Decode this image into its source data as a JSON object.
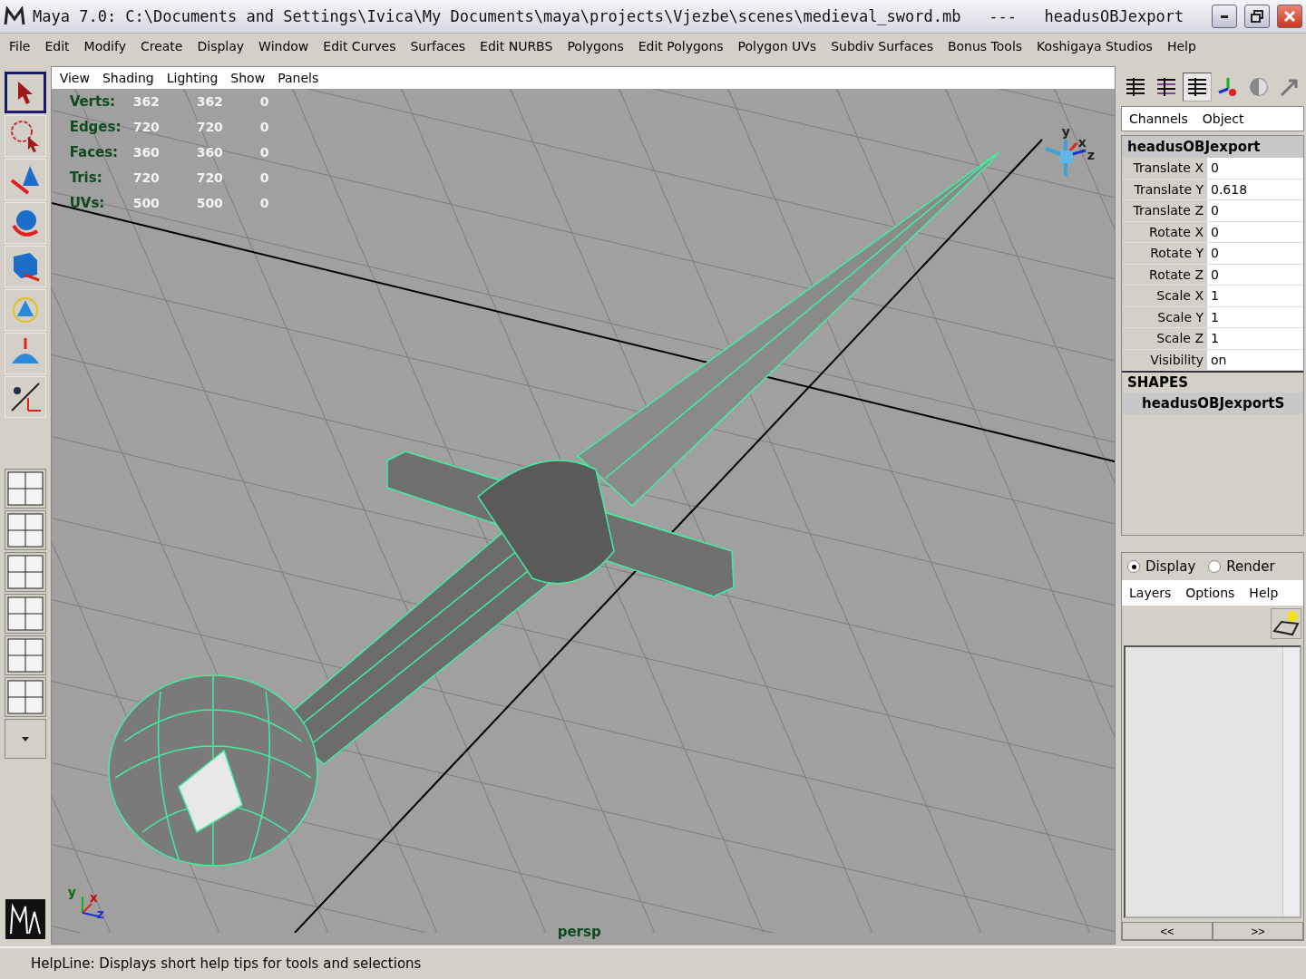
{
  "window": {
    "title": "Maya 7.0: C:\\Documents and Settings\\Ivica\\My Documents\\maya\\projects\\Vjezbe\\scenes\\medieval_sword.mb   ---   headusOBJexport"
  },
  "menu": [
    "File",
    "Edit",
    "Modify",
    "Create",
    "Display",
    "Window",
    "Edit Curves",
    "Surfaces",
    "Edit NURBS",
    "Polygons",
    "Edit Polygons",
    "Polygon UVs",
    "Subdiv Surfaces",
    "Bonus Tools",
    "Koshigaya Studios",
    "Help"
  ],
  "tools": [
    {
      "kind": "select",
      "selected": true
    },
    {
      "kind": "lasso",
      "selected": false
    },
    {
      "kind": "paint",
      "selected": false
    },
    {
      "kind": "rotate",
      "selected": false
    },
    {
      "kind": "scale",
      "selected": false
    },
    {
      "kind": "manip",
      "selected": false
    },
    {
      "kind": "soft",
      "selected": false
    },
    {
      "kind": "last",
      "selected": false
    }
  ],
  "viewport": {
    "menu": [
      "View",
      "Shading",
      "Lighting",
      "Show",
      "Panels"
    ],
    "hud": [
      {
        "label": "Verts:",
        "values": [
          "362",
          "362",
          "0"
        ]
      },
      {
        "label": "Edges:",
        "values": [
          "720",
          "720",
          "0"
        ]
      },
      {
        "label": "Faces:",
        "values": [
          "360",
          "360",
          "0"
        ]
      },
      {
        "label": "Tris:",
        "values": [
          "720",
          "720",
          "0"
        ]
      },
      {
        "label": "UVs:",
        "values": [
          "500",
          "500",
          "0"
        ]
      }
    ],
    "view_cube_axes": [
      "y",
      "x",
      "z"
    ],
    "origin_axes": [
      "y",
      "x",
      "z"
    ],
    "camera": "persp"
  },
  "channel_box": {
    "modes": [
      {
        "selected": false
      },
      {
        "selected": false
      },
      {
        "selected": true
      }
    ],
    "menu": [
      "Channels",
      "Object"
    ],
    "object": "headusOBJexport",
    "attributes": [
      {
        "name": "Translate X",
        "value": "0"
      },
      {
        "name": "Translate Y",
        "value": "0.618"
      },
      {
        "name": "Translate Z",
        "value": "0"
      },
      {
        "name": "Rotate X",
        "value": "0"
      },
      {
        "name": "Rotate Y",
        "value": "0"
      },
      {
        "name": "Rotate Z",
        "value": "0"
      },
      {
        "name": "Scale X",
        "value": "1"
      },
      {
        "name": "Scale Y",
        "value": "1"
      },
      {
        "name": "Scale Z",
        "value": "1"
      },
      {
        "name": "Visibility",
        "value": "on"
      }
    ],
    "shapes_heading": "SHAPES",
    "shape": "headusOBJexportS"
  },
  "layer_editor": {
    "modes": [
      {
        "label": "Display",
        "selected": true
      },
      {
        "label": "Render",
        "selected": false
      }
    ],
    "menu": [
      "Layers",
      "Options",
      "Help"
    ],
    "nav": [
      "<<",
      ">>"
    ]
  },
  "help_line": "HelpLine: Displays short help tips for tools and selections"
}
